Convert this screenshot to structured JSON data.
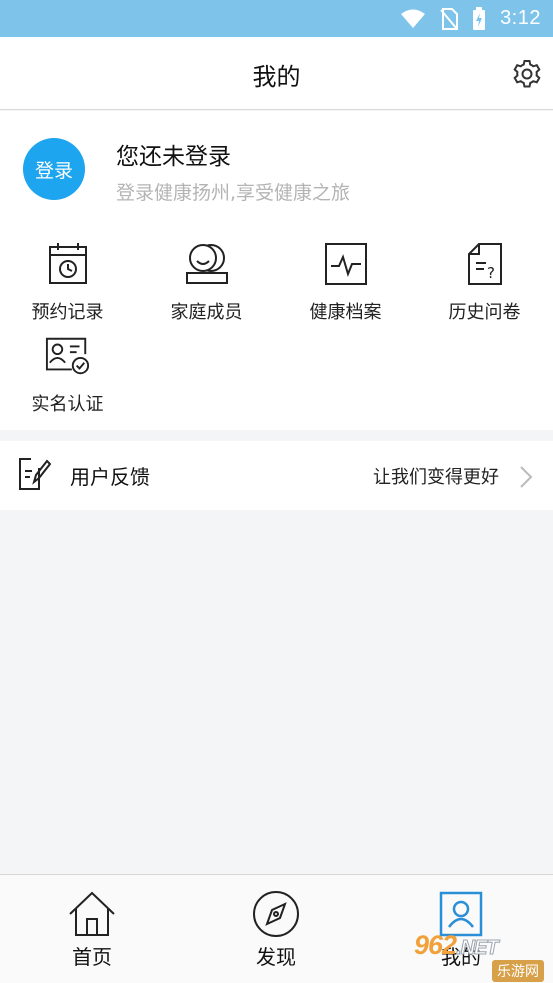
{
  "status_bar": {
    "time": "3:12",
    "icons": [
      "wifi-icon",
      "no-sim-icon",
      "battery-charging-icon"
    ],
    "background": "#7ec3ea"
  },
  "header": {
    "title": "我的",
    "settings_icon": "gear-icon"
  },
  "profile": {
    "login_button": "登录",
    "title": "您还未登录",
    "subtitle": "登录健康扬州,享受健康之旅",
    "accent": "#1ea5ef"
  },
  "shortcuts": [
    {
      "label": "预约记录",
      "icon": "calendar-clock-icon"
    },
    {
      "label": "家庭成员",
      "icon": "family-members-icon"
    },
    {
      "label": "健康档案",
      "icon": "health-record-icon"
    },
    {
      "label": "历史问卷",
      "icon": "questionnaire-icon"
    },
    {
      "label": "实名认证",
      "icon": "id-card-verified-icon"
    }
  ],
  "feedback": {
    "label": "用户反馈",
    "hint": "让我们变得更好",
    "icon": "edit-document-icon"
  },
  "bottom_nav": [
    {
      "label": "首页",
      "icon": "home-icon"
    },
    {
      "label": "发现",
      "icon": "compass-icon"
    },
    {
      "label": "我的",
      "icon": "profile-card-icon"
    }
  ],
  "watermark": {
    "top": "962",
    "top_suffix": ".NET",
    "bottom": "乐游网"
  }
}
